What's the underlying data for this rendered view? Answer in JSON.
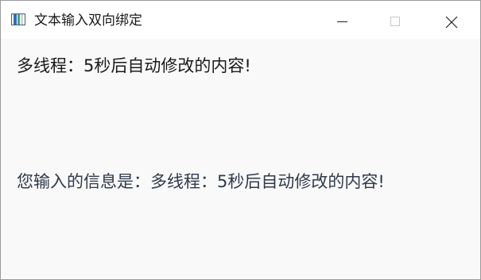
{
  "window": {
    "title": "文本输入双向绑定",
    "icon": "app-window-icon",
    "controls": {
      "minimize_icon": "minimize-icon",
      "maximize_icon": "maximize-icon",
      "close_icon": "close-icon"
    }
  },
  "main": {
    "input_value": "多线程：5秒后自动修改的内容!",
    "bound_label": "您输入的信息是：多线程：5秒后自动修改的内容!"
  },
  "colors": {
    "titlebar_bg": "#ffffff",
    "client_bg": "#f9f9f9",
    "input_text": "#1a1a1a",
    "label_text": "#2f3a4b"
  }
}
